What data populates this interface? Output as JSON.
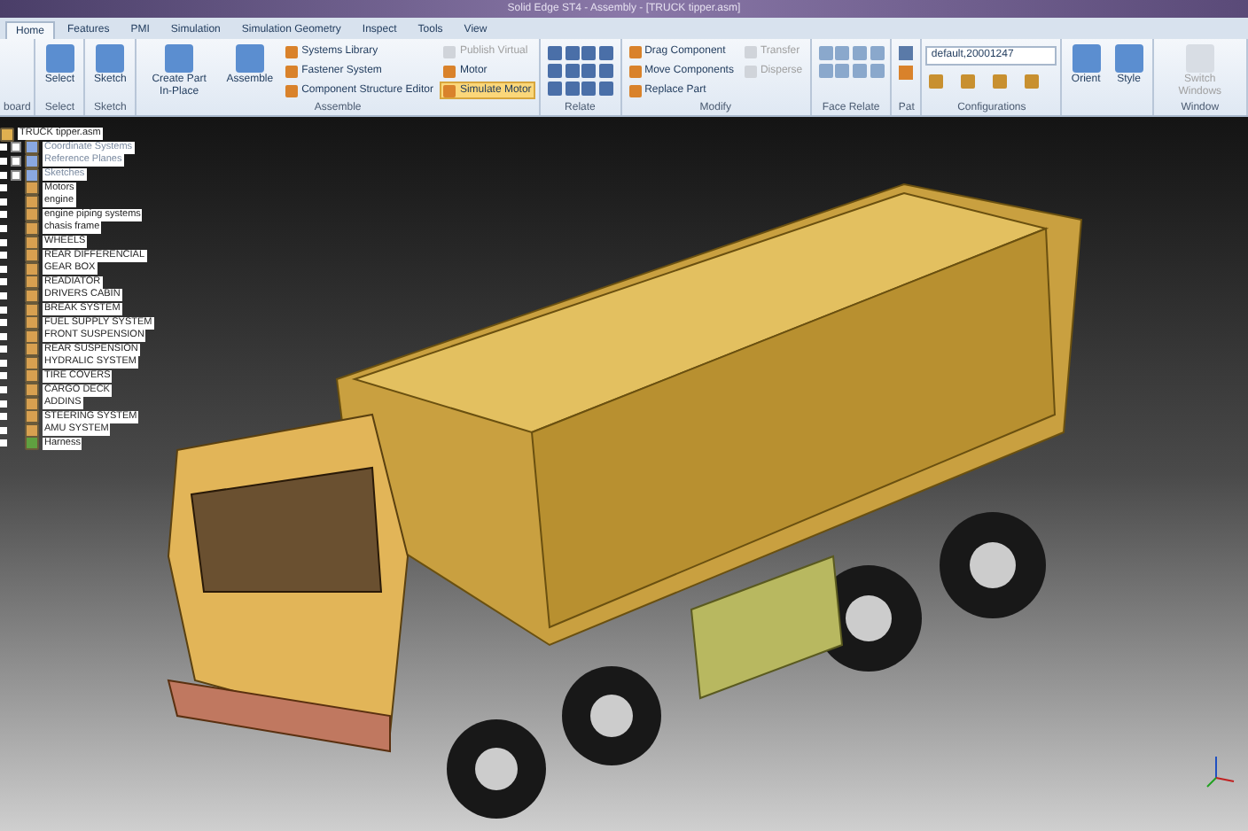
{
  "window": {
    "title": "Solid Edge ST4 - Assembly - [TRUCK tipper.asm]"
  },
  "tabs": [
    {
      "label": "Home",
      "selected": true
    },
    {
      "label": "Features",
      "selected": false
    },
    {
      "label": "PMI",
      "selected": false
    },
    {
      "label": "Simulation",
      "selected": false
    },
    {
      "label": "Simulation Geometry",
      "selected": false
    },
    {
      "label": "Inspect",
      "selected": false
    },
    {
      "label": "Tools",
      "selected": false
    },
    {
      "label": "View",
      "selected": false
    }
  ],
  "ribbon": {
    "groups": [
      {
        "label": "board"
      },
      {
        "label": "Select",
        "buttons": [
          {
            "label": "Select",
            "kind": "large",
            "disabled": false,
            "selected": false
          }
        ]
      },
      {
        "label": "Sketch",
        "buttons": [
          {
            "label": "Sketch",
            "kind": "large",
            "disabled": false,
            "selected": false
          }
        ]
      },
      {
        "label": "Assemble",
        "buttons": [
          {
            "label": "Create Part In-Place",
            "kind": "large",
            "disabled": false,
            "selected": false
          },
          {
            "label": "Assemble",
            "kind": "large",
            "disabled": false,
            "selected": false
          },
          {
            "label": "Systems Library",
            "kind": "small",
            "disabled": false,
            "selected": false
          },
          {
            "label": "Fastener System",
            "kind": "small",
            "disabled": false,
            "selected": false
          },
          {
            "label": "Component Structure Editor",
            "kind": "small",
            "disabled": false,
            "selected": false
          },
          {
            "label": "Publish Virtual",
            "kind": "small",
            "disabled": true,
            "selected": false
          },
          {
            "label": "Motor",
            "kind": "small",
            "disabled": false,
            "selected": false
          },
          {
            "label": "Simulate Motor",
            "kind": "small",
            "disabled": false,
            "selected": true
          }
        ]
      },
      {
        "label": "Relate"
      },
      {
        "label": "Modify",
        "buttons": [
          {
            "label": "Drag Component",
            "kind": "small",
            "disabled": false,
            "selected": false
          },
          {
            "label": "Move Components",
            "kind": "small",
            "disabled": false,
            "selected": false
          },
          {
            "label": "Replace Part",
            "kind": "small",
            "disabled": false,
            "selected": false
          },
          {
            "label": "Transfer",
            "kind": "small",
            "disabled": true,
            "selected": false
          },
          {
            "label": "Disperse",
            "kind": "small",
            "disabled": true,
            "selected": false
          }
        ]
      },
      {
        "label": "Face Relate"
      },
      {
        "label": "Pat"
      },
      {
        "label": "Configurations",
        "buttons": [
          {
            "label": "default,20001247",
            "kind": "dropdown"
          }
        ]
      },
      {
        "buttons": [
          {
            "label": "Orient",
            "kind": "large",
            "disabled": false,
            "selected": false
          },
          {
            "label": "Style",
            "kind": "large",
            "disabled": false,
            "selected": false
          }
        ]
      },
      {
        "label": "Window",
        "buttons": [
          {
            "label": "Switch Windows",
            "kind": "large",
            "disabled": true,
            "selected": false
          }
        ]
      }
    ]
  },
  "tree": {
    "root": "TRUCK tipper.asm",
    "items": [
      {
        "label": "Coordinate Systems",
        "kind": "system",
        "checked": false
      },
      {
        "label": "Reference Planes",
        "kind": "system",
        "checked": false
      },
      {
        "label": "Sketches",
        "kind": "system",
        "checked": false
      },
      {
        "label": "Motors",
        "kind": "part"
      },
      {
        "label": "engine",
        "kind": "part"
      },
      {
        "label": "engine piping systems",
        "kind": "part"
      },
      {
        "label": "chasis frame",
        "kind": "part"
      },
      {
        "label": "WHEELS",
        "kind": "part"
      },
      {
        "label": "REAR DIFFERENCIAL",
        "kind": "part"
      },
      {
        "label": "GEAR BOX",
        "kind": "part"
      },
      {
        "label": "READIATOR",
        "kind": "part"
      },
      {
        "label": "DRIVERS CABIN",
        "kind": "part"
      },
      {
        "label": "BREAK SYSTEM",
        "kind": "part"
      },
      {
        "label": "FUEL SUPPLY SYSTEM",
        "kind": "part"
      },
      {
        "label": "FRONT SUSPENSION",
        "kind": "part"
      },
      {
        "label": "REAR SUSPENSION",
        "kind": "part"
      },
      {
        "label": "HYDRALIC SYSTEM",
        "kind": "part"
      },
      {
        "label": "TIRE COVERS",
        "kind": "part"
      },
      {
        "label": "CARGO DECK",
        "kind": "part"
      },
      {
        "label": "ADDINS",
        "kind": "part"
      },
      {
        "label": "STEERING SYSTEM",
        "kind": "part"
      },
      {
        "label": "AMU SYSTEM",
        "kind": "part"
      },
      {
        "label": "Harness",
        "kind": "harness"
      }
    ]
  }
}
